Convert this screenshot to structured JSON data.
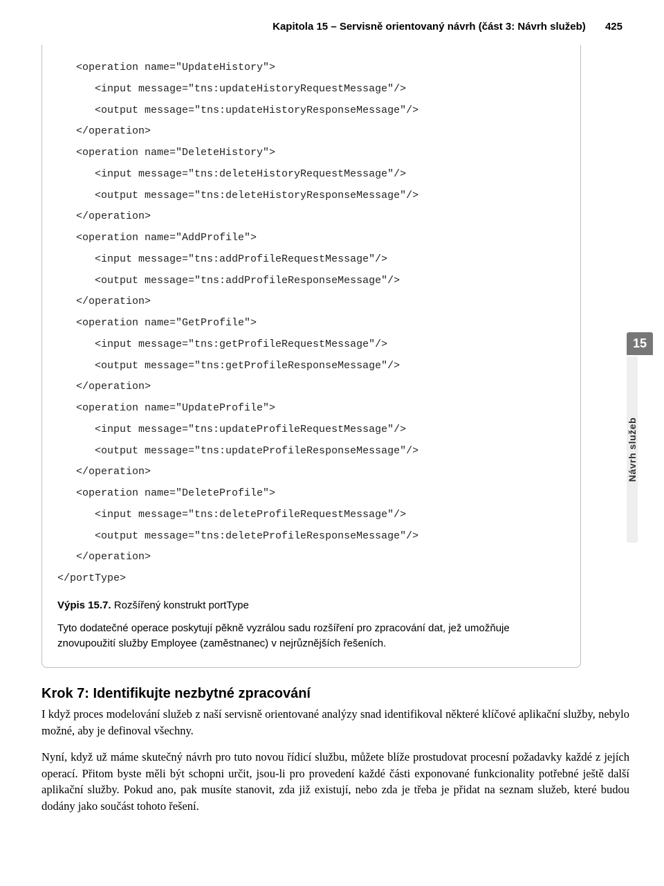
{
  "header": {
    "chapter_line": "Kapitola 15 – Servisně orientovaný návrh (část 3: Návrh služeb)",
    "page": "425"
  },
  "code_block": "   <operation name=\"UpdateHistory\">\n      <input message=\"tns:updateHistoryRequestMessage\"/>\n      <output message=\"tns:updateHistoryResponseMessage\"/>\n   </operation>\n   <operation name=\"DeleteHistory\">\n      <input message=\"tns:deleteHistoryRequestMessage\"/>\n      <output message=\"tns:deleteHistoryResponseMessage\"/>\n   </operation>\n   <operation name=\"AddProfile\">\n      <input message=\"tns:addProfileRequestMessage\"/>\n      <output message=\"tns:addProfileResponseMessage\"/>\n   </operation>\n   <operation name=\"GetProfile\">\n      <input message=\"tns:getProfileRequestMessage\"/>\n      <output message=\"tns:getProfileResponseMessage\"/>\n   </operation>\n   <operation name=\"UpdateProfile\">\n      <input message=\"tns:updateProfileRequestMessage\"/>\n      <output message=\"tns:updateProfileResponseMessage\"/>\n   </operation>\n   <operation name=\"DeleteProfile\">\n      <input message=\"tns:deleteProfileRequestMessage\"/>\n      <output message=\"tns:deleteProfileResponseMessage\"/>\n   </operation>\n</portType>",
  "caption": {
    "bold": "Výpis 15.7.",
    "rest": " Rozšířený konstrukt portType"
  },
  "note_text": "Tyto dodatečné operace poskytují pěkně vyzrálou sadu rozšíření pro zpracování dat, jež umožňuje znovupoužití služby Employee (zaměstnanec) v nejrůznějších řešeních.",
  "sidebar": {
    "number": "15",
    "label": "Návrh služeb"
  },
  "section_heading": "Krok 7: Identifikujte nezbytné zpracování",
  "para1": "I když proces modelování služeb z naší servisně orientované analýzy snad identifikoval některé klíčové aplikační služby, nebylo možné, aby je definoval všechny.",
  "para2": "Nyní, když už máme skutečný návrh pro tuto novou řídicí službu, můžete blíže prostudovat procesní požadavky každé z jejích operací. Přitom byste měli být schopni určit, jsou-li pro provedení každé části exponované funkcionality potřebné ještě další aplikační služby. Pokud ano, pak musíte stanovit, zda již existují, nebo zda je třeba je přidat na seznam služeb, které budou dodány jako součást tohoto řešení."
}
